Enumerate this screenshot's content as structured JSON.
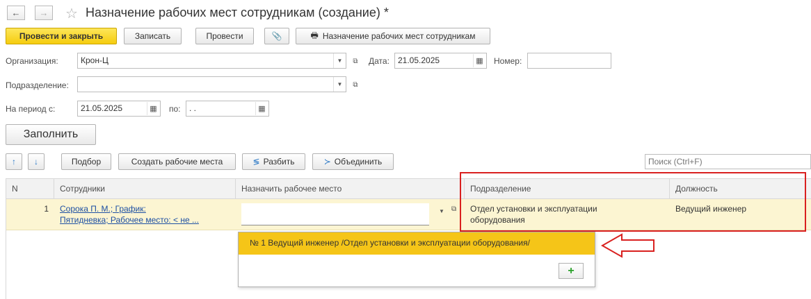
{
  "window": {
    "title": "Назначение рабочих мест сотрудникам (создание) *"
  },
  "toolbar": {
    "post_close_label": "Провести и закрыть",
    "save_label": "Записать",
    "post_label": "Провести",
    "print_label": "Назначение рабочих мест сотрудникам"
  },
  "form": {
    "org_label": "Организация:",
    "org_value": "Крон-Ц",
    "date_label": "Дата:",
    "date_value": "21.05.2025",
    "number_label": "Номер:",
    "number_value": "",
    "dept_label": "Подразделение:",
    "dept_value": "",
    "period_label": "На период с:",
    "period_from": "21.05.2025",
    "period_to_label": "по:",
    "period_to": " .  .",
    "fill_label": "Заполнить"
  },
  "table_toolbar": {
    "pick_label": "Подбор",
    "create_places_label": "Создать рабочие места",
    "split_label": "Разбить",
    "merge_label": "Объединить",
    "search_placeholder": "Поиск (Ctrl+F)"
  },
  "table": {
    "columns": [
      "N",
      "Сотрудники",
      "Назначить рабочее место",
      "Подразделение",
      "Должность"
    ],
    "rows": [
      {
        "n": "1",
        "employee_line1": "Сорока П. М.; График:",
        "employee_line2": "Пятидневка; Рабочее место: < не ...",
        "workplace": "",
        "dept_line1": "Отдел установки и эксплуатации",
        "dept_line2": "оборудования",
        "position": "Ведущий инженер"
      }
    ]
  },
  "dropdown": {
    "option": "№ 1 Ведущий инженер /Отдел установки и эксплуатации оборудования/"
  },
  "colors": {
    "primary_button": "#f5cc0e",
    "row_highlight": "#fcf5d2",
    "dropdown_highlight": "#f5c518",
    "annotation_red": "#d9201f"
  }
}
